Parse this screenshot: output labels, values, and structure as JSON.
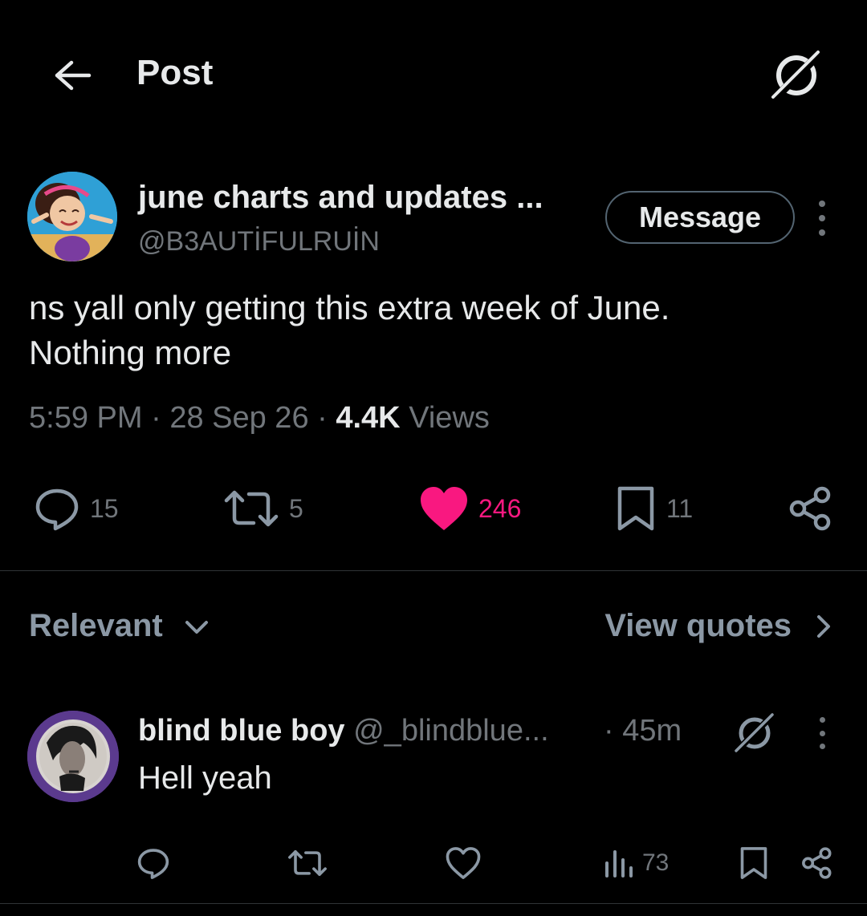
{
  "header": {
    "title": "Post"
  },
  "post": {
    "author_name": "june charts and updates ...",
    "author_handle": "@B3AUTİFULRUİN",
    "message_label": "Message",
    "text": "ns yall only getting this extra week of June.\nNothing more",
    "time": "5:59 PM",
    "date": "28 Sep 26",
    "views_count": "4.4K",
    "views_label": "Views",
    "separator": "·",
    "replies": "15",
    "reposts": "5",
    "likes": "246",
    "bookmarks": "11",
    "liked": true,
    "like_color": "#f91880"
  },
  "replies_section": {
    "sort_label": "Relevant",
    "quotes_label": "View quotes"
  },
  "reply": {
    "name": "blind blue boy",
    "handle": "@_blindblue...",
    "time": "· 45m",
    "text": "Hell yeah",
    "views": "73"
  }
}
